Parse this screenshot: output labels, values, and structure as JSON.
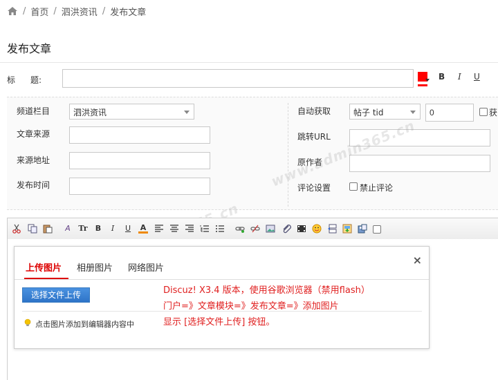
{
  "breadcrumb": {
    "items": [
      "首页",
      "泗洪资讯",
      "发布文章"
    ],
    "separator": "/"
  },
  "page_title": "发布文章",
  "title_field": {
    "label_a": "标",
    "label_b": "题:",
    "value": "",
    "color": "#ff0000",
    "bold_label": "B",
    "italic_label": "I",
    "underline_label": "U"
  },
  "meta": {
    "channel_label": "频道栏目",
    "channel_value": "泗洪资讯",
    "source_label": "文章来源",
    "source_url_label": "来源地址",
    "publish_time_label": "发布时间",
    "auto_fetch_label": "自动获取",
    "auto_fetch_value": "帖子 tid",
    "auto_fetch_number": "0",
    "auto_fetch_checkbox_label": "获",
    "jump_url_label": "跳转URL",
    "author_label": "原作者",
    "comment_label": "评论设置",
    "disable_comment_label": "禁止评论"
  },
  "watermark_text": "www.admin365.cn",
  "dialog": {
    "tabs": [
      "上传图片",
      "相册图片",
      "网络图片"
    ],
    "close_label": "×",
    "upload_button": "选择文件上传",
    "tip": "点击图片添加到编辑器内容中",
    "note_lines": [
      "Discuz! X3.4 版本，使用谷歌浏览器（禁用flash）",
      "门户=》文章模块=》发布文章=》添加图片",
      "显示 [选择文件上传] 按钮。"
    ]
  }
}
